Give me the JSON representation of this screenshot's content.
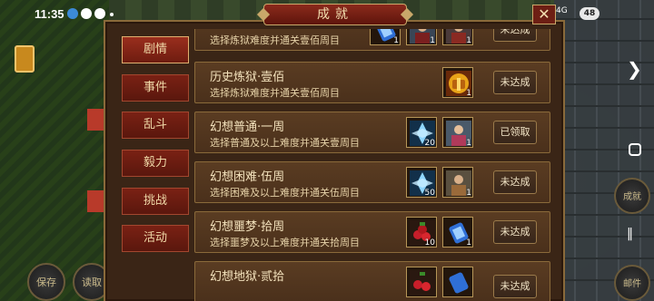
{
  "status_bar": {
    "time": "11:35",
    "network": "4G",
    "battery": "48"
  },
  "header": {
    "title": "成就",
    "close_label": "✕"
  },
  "sidebar": {
    "tabs": [
      {
        "label": "剧情",
        "active": true
      },
      {
        "label": "事件",
        "active": false
      },
      {
        "label": "乱斗",
        "active": false
      },
      {
        "label": "毅力",
        "active": false
      },
      {
        "label": "挑战",
        "active": false
      },
      {
        "label": "活动",
        "active": false
      }
    ]
  },
  "achievements": [
    {
      "title": "",
      "desc": "选择炼狱难度并通关壹佰周目",
      "status": "未达成",
      "rewards": [
        {
          "icon": "scroll-icon",
          "qty": "1"
        },
        {
          "icon": "general-portrait-icon",
          "qty": "1"
        },
        {
          "icon": "general-portrait-icon",
          "qty": "1"
        }
      ]
    },
    {
      "title": "历史炼狱·壹佰",
      "desc": "选择炼狱难度并通关壹佰周目",
      "status": "未达成",
      "rewards": [
        {
          "icon": "gold-treasure-icon",
          "qty": "1"
        }
      ]
    },
    {
      "title": "幻想普通·一周",
      "desc": "选择普通及以上难度并通关壹周目",
      "status": "已领取",
      "rewards": [
        {
          "icon": "crystal-icon",
          "qty": "20"
        },
        {
          "icon": "general-portrait-icon",
          "qty": "1"
        }
      ]
    },
    {
      "title": "幻想困难·伍周",
      "desc": "选择困难及以上难度并通关伍周目",
      "status": "未达成",
      "rewards": [
        {
          "icon": "crystal-icon",
          "qty": "50"
        },
        {
          "icon": "general-portrait-icon",
          "qty": "1"
        }
      ]
    },
    {
      "title": "幻想噩梦·拾周",
      "desc": "选择噩梦及以上难度并通关拾周目",
      "status": "未达成",
      "rewards": [
        {
          "icon": "fruit-icon",
          "qty": "10"
        },
        {
          "icon": "scroll-icon",
          "qty": "1"
        }
      ]
    },
    {
      "title": "幻想地狱·贰拾",
      "desc": "",
      "status": "未达成",
      "rewards": [
        {
          "icon": "fruit-icon",
          "qty": ""
        },
        {
          "icon": "scroll-icon",
          "qty": ""
        }
      ]
    }
  ],
  "left_controls": {
    "save_label": "保存",
    "load_label": "读取"
  },
  "right_controls": {
    "skill_label": "成就",
    "mail_label": "邮件"
  },
  "colors": {
    "panel_bg": "#3a2516",
    "tab_red": "#7a2114",
    "gold_border": "#c9a86a"
  }
}
